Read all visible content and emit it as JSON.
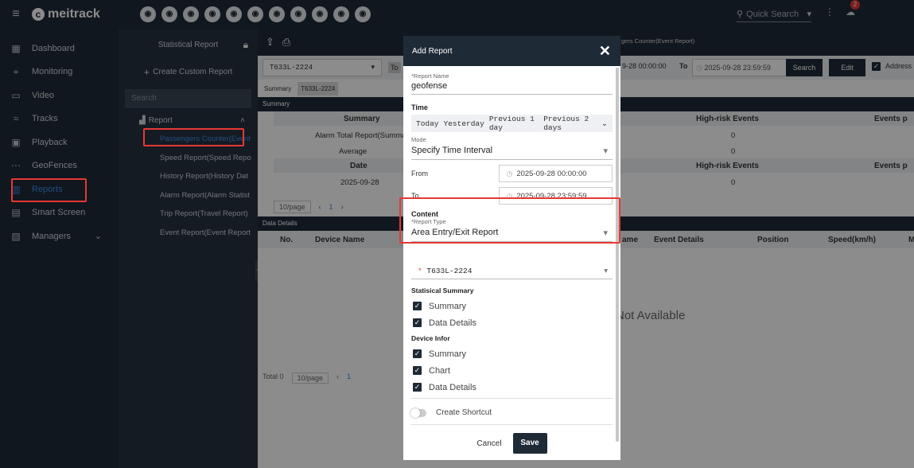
{
  "app": {
    "logo": "meitrack",
    "search_placeholder": "Quick Search",
    "notification_count": "2"
  },
  "top_icons": [
    "monitor",
    "playback",
    "location",
    "message",
    "track",
    "fence",
    "user",
    "car",
    "card",
    "calendar",
    "power"
  ],
  "sidebar": {
    "items": [
      {
        "label": "Dashboard",
        "icon": "dashboard-icon",
        "glyph": "▦"
      },
      {
        "label": "Monitoring",
        "icon": "location-icon",
        "glyph": "⌖"
      },
      {
        "label": "Video",
        "icon": "video-icon",
        "glyph": "▭"
      },
      {
        "label": "Tracks",
        "icon": "tracks-icon",
        "glyph": "≈"
      },
      {
        "label": "Playback",
        "icon": "playback-icon",
        "glyph": "▣"
      },
      {
        "label": "GeoFences",
        "icon": "geofence-icon",
        "glyph": "⋯"
      },
      {
        "label": "Reports",
        "icon": "reports-icon",
        "glyph": "▥"
      },
      {
        "label": "Smart Screen",
        "icon": "screen-icon",
        "glyph": "▤"
      },
      {
        "label": "Managers",
        "icon": "managers-icon",
        "glyph": "▧"
      }
    ]
  },
  "panel2": {
    "title": "Statistical Report",
    "create_label": "Create Custom Report",
    "search_placeholder": "Search",
    "report_group": "Report",
    "reports": [
      "Passengers Counter(Event",
      "Speed Report(Speed Repo",
      "History Report(History Dat",
      "Alarm Report(Alarm Statist",
      "Trip Report(Travel Report)",
      "Event Report(Event Report"
    ]
  },
  "main": {
    "device_select": "T633L-2224",
    "to_label": "To",
    "breadcrumb": "gers Counter(Event Report)",
    "from_value": "9-28 00:00:00",
    "to_value": "2025-09-28 23:59:59",
    "search_btn": "Search",
    "edit_btn": "Edit",
    "address_label": "Address",
    "tabs": [
      "Summary",
      "T633L-2224"
    ],
    "summary_bar": "Summary",
    "summary_header": "Summary",
    "summary_rows": [
      "Alarm Total Report(Summa",
      "Average"
    ],
    "date_header": "Date",
    "date_row": "2025-09-28",
    "highrisk_header": "High-risk Events",
    "highrisk_values": [
      "0",
      "0",
      "0"
    ],
    "events_header": "Events p",
    "page_size": "10/page",
    "page_num": "1",
    "details_bar": "Data Details",
    "columns": [
      "No.",
      "Device Name",
      "ame",
      "Event Details",
      "Position",
      "Speed(km/h)",
      "M"
    ],
    "empty": "Not Available",
    "total": "Total 0",
    "page_num2": "1"
  },
  "modal": {
    "title": "Add Report",
    "name_label": "*Report Name",
    "name_value": "geofense",
    "time_label": "Time",
    "quick_ranges": [
      "Today",
      "Yesterday",
      "Previous 1 day",
      "Previous 2 days"
    ],
    "mode_label": "Mode",
    "mode_value": "Specify Time Interval",
    "from_label": "From",
    "from_value": "2025-09-28 00:00:00",
    "to_label": "To",
    "to_value": "2025-09-28 23:59:59",
    "content_label": "Content",
    "type_label": "*Report Type",
    "type_value": "Area Entry/Exit Report",
    "device_value": "T633L-2224",
    "stat_summary_label": "Statisical Summary",
    "stat_items": [
      "Summary",
      "Data Details"
    ],
    "device_info_label": "Device Infor",
    "device_items": [
      "Summary",
      "Chart",
      "Data Details"
    ],
    "shortcut_label": "Create Shortcut",
    "cancel": "Cancel",
    "save": "Save"
  }
}
